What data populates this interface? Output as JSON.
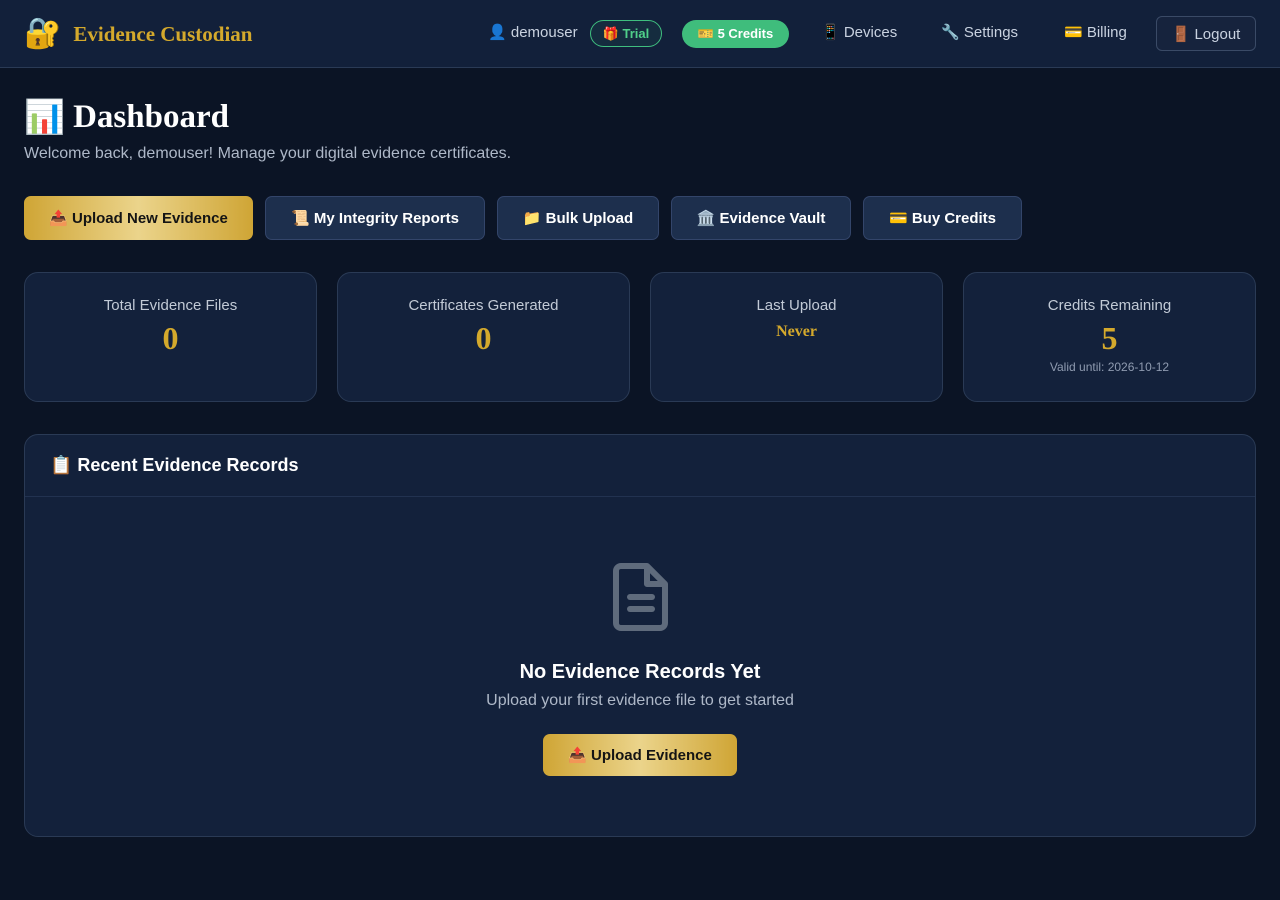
{
  "header": {
    "brand_icon": "🔐",
    "brand_title": "Evidence Custodian",
    "user_icon": "👤",
    "username": "demouser",
    "trial_badge": "🎁 Trial",
    "credits_badge": "🎫 5 Credits",
    "nav": {
      "devices": "📱 Devices",
      "settings": "🔧 Settings",
      "billing": "💳 Billing",
      "logout": "🚪 Logout"
    }
  },
  "page": {
    "title_icon": "📊",
    "title": "Dashboard",
    "subtitle": "Welcome back, demouser! Manage your digital evidence certificates."
  },
  "actions": {
    "upload": "📤 Upload New Evidence",
    "reports": "📜 My Integrity Reports",
    "bulk": "📁 Bulk Upload",
    "vault": "🏛️ Evidence Vault",
    "buy": "💳 Buy Credits"
  },
  "stats": [
    {
      "label": "Total Evidence Files",
      "value": "0"
    },
    {
      "label": "Certificates Generated",
      "value": "0"
    },
    {
      "label": "Last Upload",
      "value": "Never"
    },
    {
      "label": "Credits Remaining",
      "value": "5",
      "note": "Valid until: 2026-10-12"
    }
  ],
  "records": {
    "title": "📋 Recent Evidence Records",
    "empty_icon": "document-icon",
    "empty_title": "No Evidence Records Yet",
    "empty_subtitle": "Upload your first evidence file to get started",
    "empty_button": "📤 Upload Evidence"
  },
  "colors": {
    "background": "#0b1425",
    "gold": "#d4a92c",
    "green": "#3fbd7c"
  }
}
